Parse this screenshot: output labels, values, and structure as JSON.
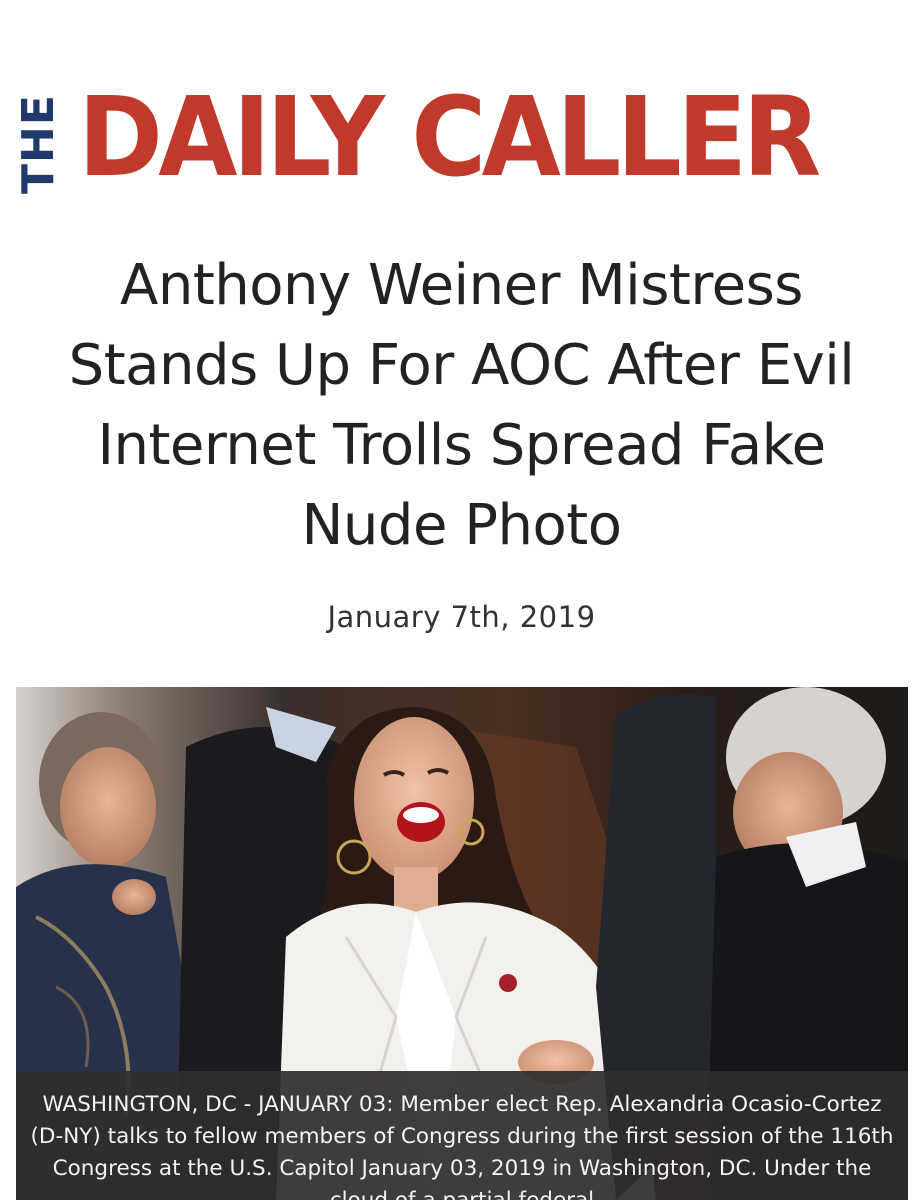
{
  "masthead": {
    "prefix": "THE",
    "name": "DAILY CALLER",
    "brand_color": "#c0392b",
    "prefix_color": "#1f3a6b"
  },
  "article": {
    "headline": "Anthony Weiner Mistress Stands Up For AOC After Evil Internet Trolls Spread Fake Nude Photo",
    "date": "January 7th, 2019"
  },
  "photo": {
    "icon": "news-photo",
    "caption": "WASHINGTON, DC - JANUARY 03: Member elect Rep. Alexandria Ocasio-Cortez (D-NY) talks to fellow members of Congress during the first session of the 116th Congress at the U.S. Capitol January 03, 2019 in Washington, DC. Under the cloud of a partial federal"
  }
}
